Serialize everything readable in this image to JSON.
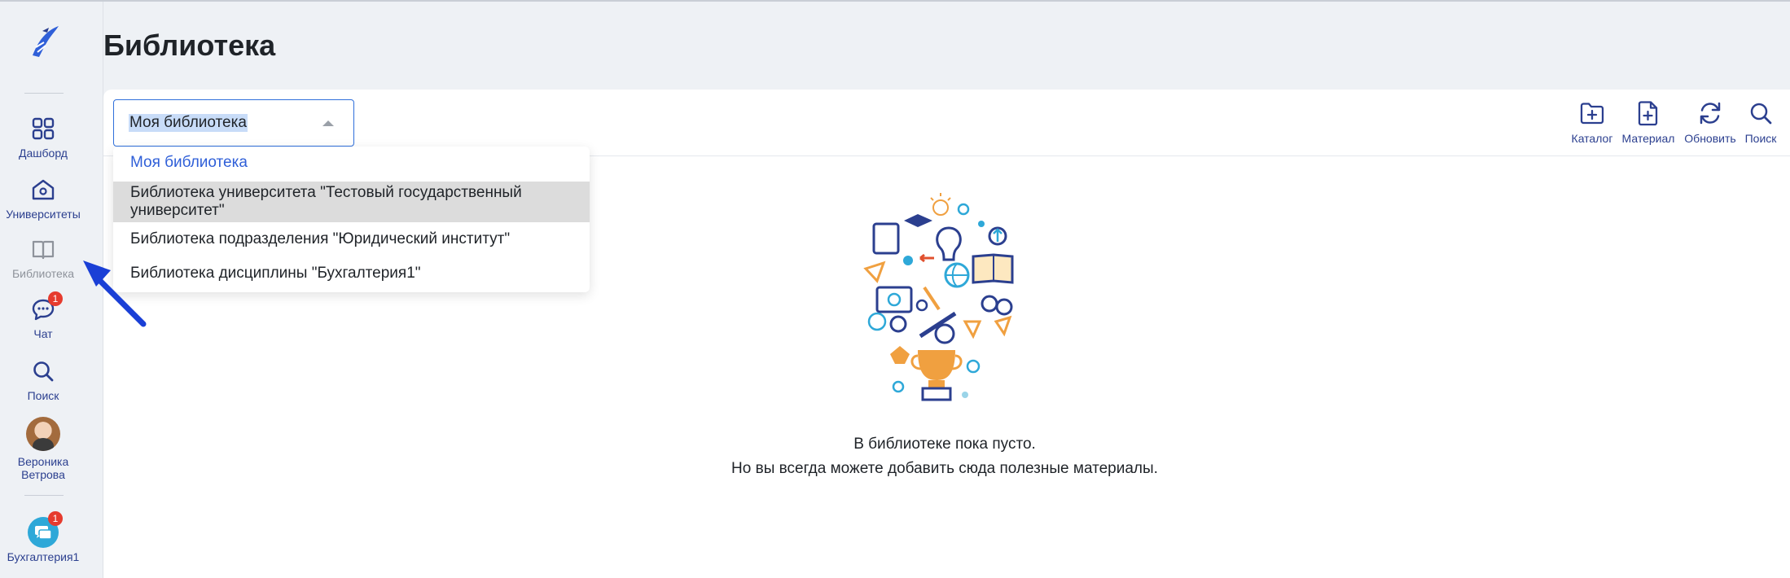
{
  "page": {
    "title": "Библиотека"
  },
  "sidebar": {
    "items": [
      {
        "label": "Дашборд",
        "icon": "grid-icon"
      },
      {
        "label": "Университеты",
        "icon": "university-icon"
      },
      {
        "label": "Библиотека",
        "icon": "book-icon",
        "active": true
      },
      {
        "label": "Чат",
        "icon": "chat-icon",
        "badge": "1"
      },
      {
        "label": "Поиск",
        "icon": "search-icon"
      }
    ],
    "user": {
      "name_line1": "Вероника",
      "name_line2": "Ветрова"
    },
    "group": {
      "label": "Бухгалтерия1",
      "badge": "1",
      "icon": "group-chat-icon"
    }
  },
  "library_select": {
    "value": "Моя библиотека",
    "options": [
      "Моя библиотека",
      "Библиотека университета \"Тестовый государственный университет\"",
      "Библиотека подразделения \"Юридический институт\"",
      "Библиотека дисциплины \"Бухгалтерия1\""
    ]
  },
  "toolbar": {
    "catalog_label": "Каталог",
    "material_label": "Материал",
    "refresh_label": "Обновить",
    "search_label": "Поиск"
  },
  "empty_state": {
    "line1": "В библиотеке пока пусто.",
    "line2": "Но вы всегда можете добавить сюда полезные материалы."
  },
  "colors": {
    "accent": "#2b3f8f",
    "link": "#2f5fd8",
    "badge": "#e63b2e",
    "arrow": "#1a3fd6"
  }
}
